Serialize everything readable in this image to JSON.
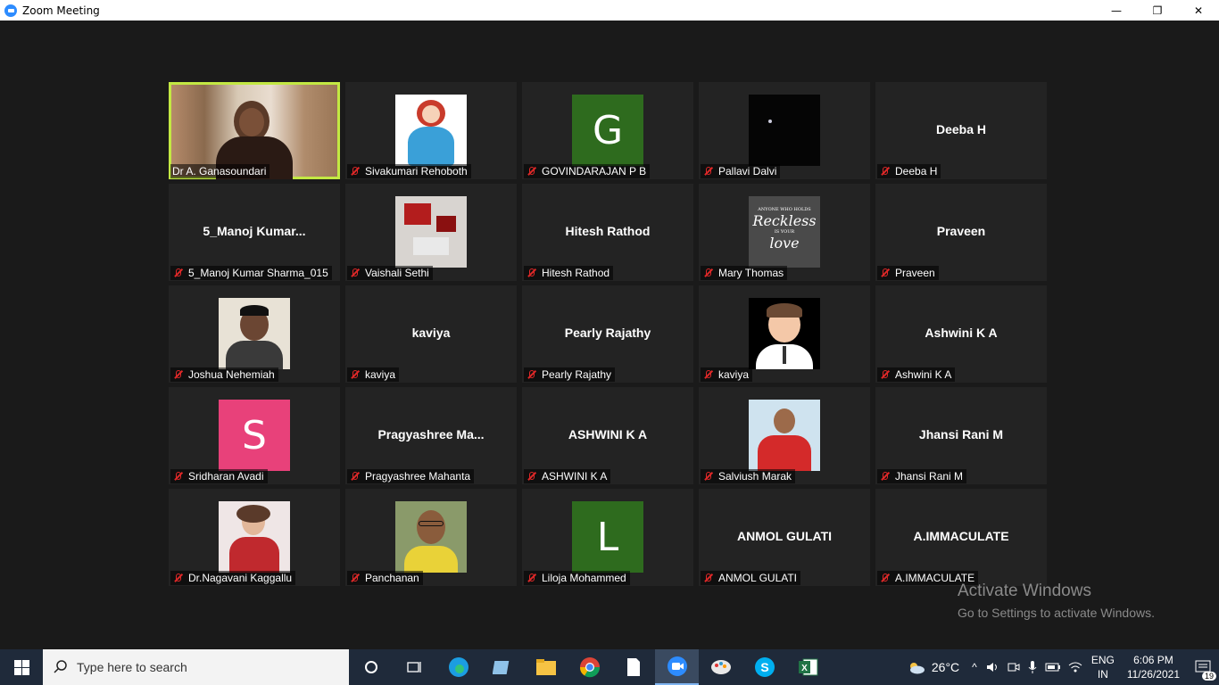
{
  "window": {
    "title": "Zoom Meeting",
    "minimize": "—",
    "maximize": "❐",
    "close": "✕"
  },
  "colors": {
    "active_speaker": "#c3e843",
    "green_avatar": "#2e6b1e",
    "pink_avatar": "#e8417a",
    "muted": "#e02828"
  },
  "participants": [
    {
      "label": "Dr A. Ganasoundari",
      "display": "",
      "type": "video",
      "muted": false,
      "active": true
    },
    {
      "label": "Sivakumari Rehoboth",
      "display": "",
      "type": "photo",
      "photo": "cartoon-princess",
      "muted": true
    },
    {
      "label": "GOVINDARAJAN P B",
      "display": "",
      "type": "letter",
      "letter": "G",
      "muted": true
    },
    {
      "label": "Pallavi Dalvi",
      "display": "",
      "type": "photo",
      "photo": "dark",
      "muted": true
    },
    {
      "label": "Deeba H",
      "display": "Deeba H",
      "type": "name",
      "muted": true
    },
    {
      "label": "5_Manoj Kumar Sharma_015",
      "display": "5_Manoj  Kumar...",
      "type": "name",
      "muted": true
    },
    {
      "label": "Vaishali Sethi",
      "display": "",
      "type": "photo",
      "photo": "red-items",
      "muted": true
    },
    {
      "label": "Hitesh Rathod",
      "display": "Hitesh Rathod",
      "type": "name",
      "muted": true
    },
    {
      "label": "Mary Thomas",
      "display": "",
      "type": "photo",
      "photo": "quote",
      "muted": true
    },
    {
      "label": "Praveen",
      "display": "Praveen",
      "type": "name",
      "muted": true
    },
    {
      "label": "Joshua Nehemiah",
      "display": "",
      "type": "photo",
      "photo": "man-suit",
      "muted": true
    },
    {
      "label": "kaviya",
      "display": "kaviya",
      "type": "name",
      "muted": true
    },
    {
      "label": "Pearly Rajathy",
      "display": "Pearly Rajathy",
      "type": "name",
      "muted": true
    },
    {
      "label": "kaviya",
      "display": "",
      "type": "photo",
      "photo": "avatar-man",
      "muted": true
    },
    {
      "label": "Ashwini K A",
      "display": "Ashwini K A",
      "type": "name",
      "muted": true
    },
    {
      "label": "Sridharan Avadi",
      "display": "",
      "type": "letter",
      "letter": "S",
      "muted": true
    },
    {
      "label": "Pragyashree Mahanta",
      "display": "Pragyashree  Ma...",
      "type": "name",
      "muted": true
    },
    {
      "label": "ASHWINI K A",
      "display": "ASHWINI K A",
      "type": "name",
      "muted": true
    },
    {
      "label": "Salviush Marak",
      "display": "",
      "type": "photo",
      "photo": "man-red",
      "muted": true
    },
    {
      "label": "Jhansi Rani M",
      "display": "Jhansi Rani M",
      "type": "name",
      "muted": true
    },
    {
      "label": "Dr.Nagavani Kaggallu",
      "display": "",
      "type": "photo",
      "photo": "woman-saree",
      "muted": true
    },
    {
      "label": "Panchanan",
      "display": "",
      "type": "photo",
      "photo": "man-glasses",
      "muted": true
    },
    {
      "label": "Liloja Mohammed",
      "display": "",
      "type": "letter",
      "letter": "L",
      "muted": true
    },
    {
      "label": "ANMOL GULATI",
      "display": "ANMOL GULATI",
      "type": "name",
      "muted": true
    },
    {
      "label": "A.IMMACULATE",
      "display": "A.IMMACULATE",
      "type": "name",
      "muted": true
    }
  ],
  "watermark": {
    "line1": "Activate Windows",
    "line2": "Go to Settings to activate Windows."
  },
  "taskbar": {
    "search_placeholder": "Type here to search",
    "weather": "26°C",
    "lang1": "ENG",
    "lang2": "IN",
    "time": "6:06 PM",
    "date": "11/26/2021",
    "notifications": "19"
  }
}
